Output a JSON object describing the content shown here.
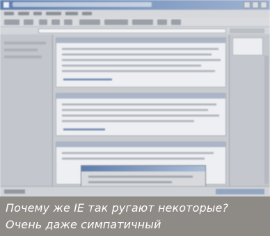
{
  "caption": {
    "line1": "Почему же IE так ругают некоторые?",
    "line2": "Очень даже симпатичный"
  },
  "browser": {
    "icons": [
      "browser-icon",
      "minimize-icon",
      "maximize-icon",
      "close-icon"
    ]
  },
  "colors": {
    "caption_background": "#8e8a86",
    "caption_text": "#ffffff",
    "titlebar": "#5b7fb8"
  }
}
